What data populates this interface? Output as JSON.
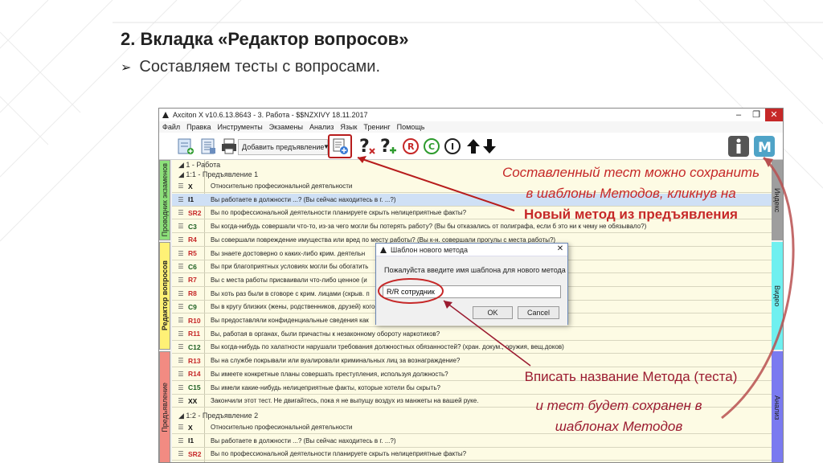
{
  "slide": {
    "title": "2. Вкладка «Редактор вопросов»",
    "bullet": "Составляем тесты с вопросами."
  },
  "window": {
    "title": "Axciton X v10.6.13.8643 - 3. Работа - $$NZXIVY 18.11.2017",
    "controls": [
      "–",
      "❐",
      "✕"
    ]
  },
  "menu": [
    "Файл",
    "Правка",
    "Инструменты",
    "Экзамены",
    "Анализ",
    "Язык",
    "Тренинг",
    "Помощь"
  ],
  "toolbar": {
    "dropdown_label": "Добавить предъявление"
  },
  "side_tabs": {
    "left": [
      "Проводник экзаменов",
      "Редактор вопросов",
      "Предъявление"
    ],
    "right": [
      "Индекс",
      "Видео",
      "Анализ"
    ]
  },
  "groups": {
    "g1": "1 - Работа",
    "g1_1": "1:1 - Предъявление 1",
    "g1_2": "1:2 - Предъявление 2"
  },
  "questions": [
    {
      "code": "X",
      "text": "Относительно професиональной деятельности"
    },
    {
      "code": "I1",
      "text": "Вы работаете в должности ...? (Вы сейчас находитесь в г. ...?)"
    },
    {
      "code": "SR2",
      "text": "Вы по профессиональной деятельности планируете скрыть нелицеприятные факты?"
    },
    {
      "code": "C3",
      "text": "Вы когда-нибудь совершали что-то, из-за чего могли бы потерять работу? (Вы бы отказались от полиграфа, если б это ни к чему не обязывало?)"
    },
    {
      "code": "R4",
      "text": "Вы совершали повреждение имущества или вред по месту работы? (Вы к-н. совершали прогулы с места работы?)"
    },
    {
      "code": "R5",
      "text": "Вы знаете достоверно о каких-либо крим. деятельн"
    },
    {
      "code": "C6",
      "text": "Вы при благоприятных условиях могли бы обогатить"
    },
    {
      "code": "R7",
      "text": "Вы с места работы присваивали что-либо ценное (и"
    },
    {
      "code": "R8",
      "text": "Вы хоть раз были в сговоре с крим. лицами (скрыв. п"
    },
    {
      "code": "C9",
      "text": "Вы в кругу близких (жены, родственников, друзей) кого-"
    },
    {
      "code": "R10",
      "text": "Вы предоставляли конфиденциальные сведения как"
    },
    {
      "code": "R11",
      "text": "Вы, работая в органах, были причастны к незаконному обороту наркотиков?"
    },
    {
      "code": "C12",
      "text": "Вы когда-нибудь по халатности нарушали требования должностных обязанностей? (хран. докум., оружия, вещ.доков)"
    },
    {
      "code": "R13",
      "text": "Вы на службе покрывали или вуалировали криминальных лиц за вознаграждение?"
    },
    {
      "code": "R14",
      "text": "Вы имеете конкретные планы совершать преступления, используя должность?"
    },
    {
      "code": "C15",
      "text": "Вы имели какие-нибудь нелицеприятные факты, которые хотели бы скрыть?"
    },
    {
      "code": "XX",
      "text": "Закончили этот тест. Не двигайтесь, пока я не выпущу воздух из манжеты на вашей руке."
    }
  ],
  "questions2": [
    {
      "code": "X",
      "text": "Относительно професиональной деятельности"
    },
    {
      "code": "I1",
      "text": "Вы работаете в должности ...? (Вы сейчас находитесь в г. ...?)"
    },
    {
      "code": "SR2",
      "text": "Вы по профессиональной деятельности планируете скрыть нелицеприятные факты?"
    }
  ],
  "dialog": {
    "title": "Шаблон нового метода",
    "prompt": "Пожалуйста введите имя шаблона для нового метода",
    "value": "R/R сотрудник",
    "ok": "OK",
    "cancel": "Cancel"
  },
  "annotations": {
    "a1_line1": "Составленный тест можно сохранить",
    "a1_line2": "в шаблоны Методов, кликнув на",
    "a1_line3": "Новый метод из предъявления",
    "a2": "Вписать название Метода (теста)",
    "a3_line1": "и тест будет сохранен в",
    "a3_line2": "шаблонах Методов"
  },
  "colors": {
    "code_red": "#c62828",
    "code_green": "#1b5e20",
    "annotation_red": "#c62828",
    "tab_green": "#8de07a",
    "tab_yellow": "#fff176",
    "tab_red": "#f28b82",
    "tab_gray": "#9e9e9e",
    "tab_cyan": "#6ff0f0",
    "tab_blue": "#7a7af0"
  }
}
